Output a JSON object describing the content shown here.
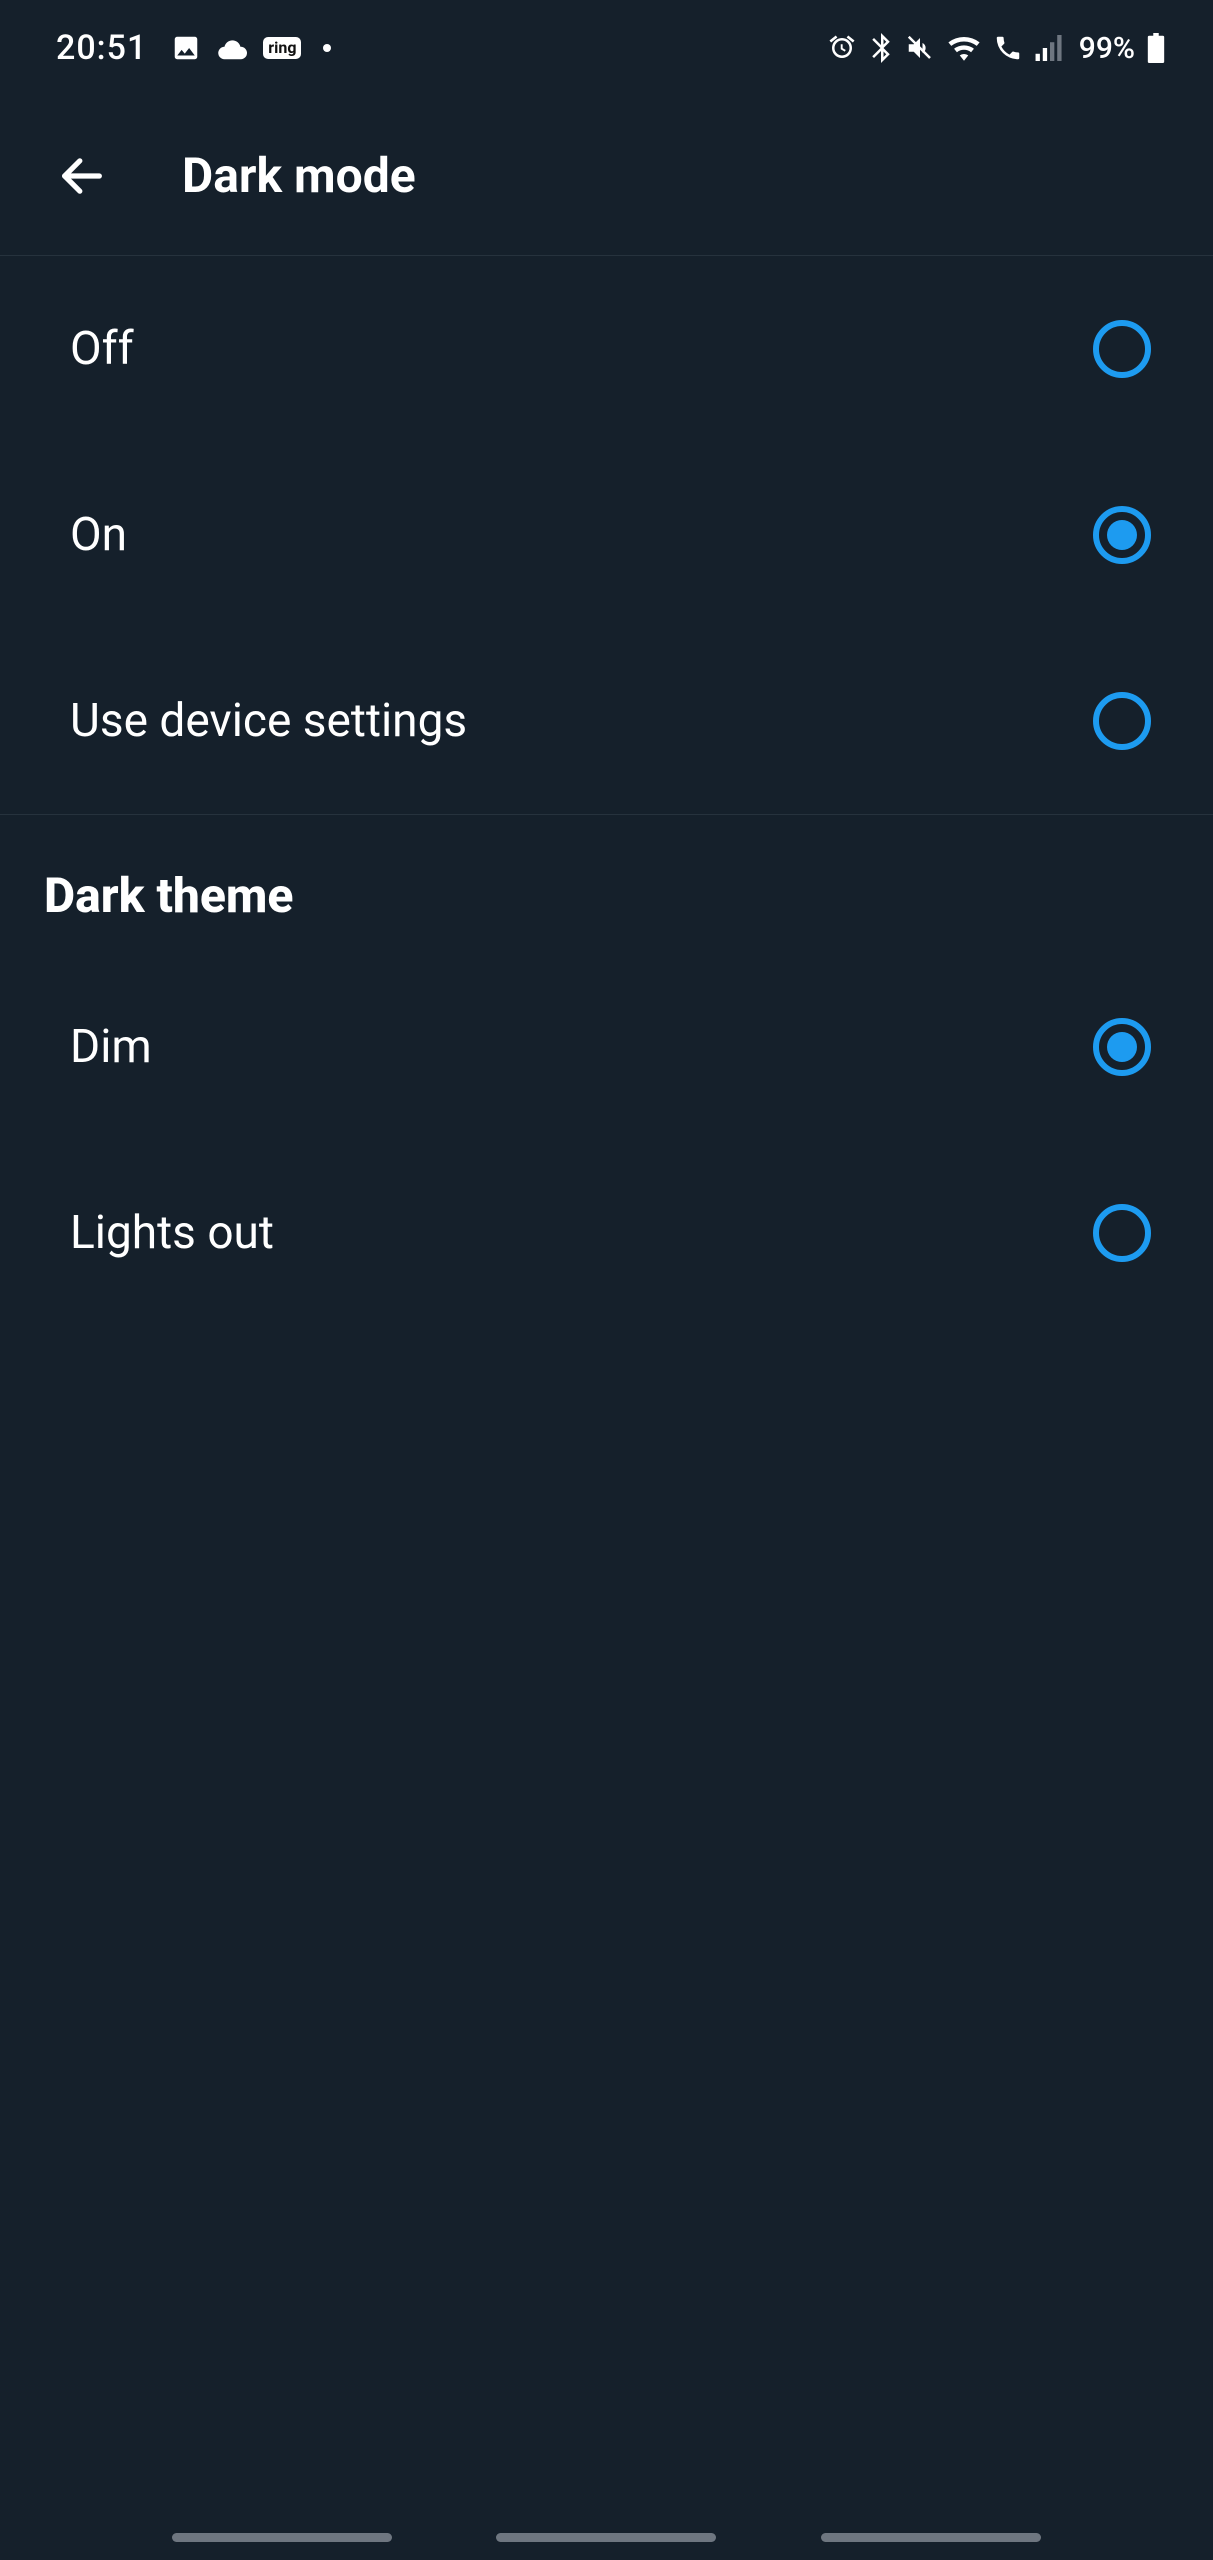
{
  "status": {
    "time": "20:51",
    "battery": "99%"
  },
  "header": {
    "title": "Dark mode"
  },
  "mode_options": [
    {
      "label": "Off",
      "selected": false
    },
    {
      "label": "On",
      "selected": true
    },
    {
      "label": "Use device settings",
      "selected": false
    }
  ],
  "theme_section_title": "Dark theme",
  "theme_options": [
    {
      "label": "Dim",
      "selected": true
    },
    {
      "label": "Lights out",
      "selected": false
    }
  ],
  "colors": {
    "background": "#15202b",
    "accent": "#1d9bf0",
    "text": "#ffffff",
    "divider": "#26323d"
  }
}
